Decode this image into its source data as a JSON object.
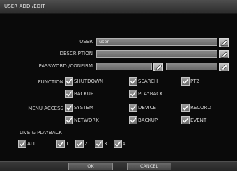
{
  "window": {
    "title": "USER ADD /EDIT"
  },
  "form": {
    "user_label": "USER",
    "user_value": "user",
    "description_label": "DESCRIPTION",
    "description_value": "",
    "password_label": "PASSWORD /CONFIRM",
    "password_value": "",
    "confirm_value": ""
  },
  "function": {
    "label": "FUNCTION",
    "items": [
      {
        "label": "SHUTDOWN",
        "checked": true
      },
      {
        "label": "SEARCH",
        "checked": true
      },
      {
        "label": "PTZ",
        "checked": true
      },
      {
        "label": "BACKUP",
        "checked": true
      },
      {
        "label": "PLAYBACK",
        "checked": true
      }
    ]
  },
  "menu_access": {
    "label": "MENU ACCESS",
    "items": [
      {
        "label": "SYSTEM",
        "checked": true
      },
      {
        "label": "DEVICE",
        "checked": true
      },
      {
        "label": "RECORD",
        "checked": true
      },
      {
        "label": "NETWORK",
        "checked": true
      },
      {
        "label": "BACKUP",
        "checked": true
      },
      {
        "label": "EVENT",
        "checked": true
      }
    ]
  },
  "live_playback": {
    "label": "LIVE & PLAYBACK",
    "items": [
      {
        "label": "ALL",
        "checked": true
      },
      {
        "label": "1",
        "checked": true
      },
      {
        "label": "2",
        "checked": true
      },
      {
        "label": "3",
        "checked": true
      },
      {
        "label": "4",
        "checked": true
      }
    ]
  },
  "buttons": {
    "ok": "OK",
    "cancel": "CANCEL"
  }
}
